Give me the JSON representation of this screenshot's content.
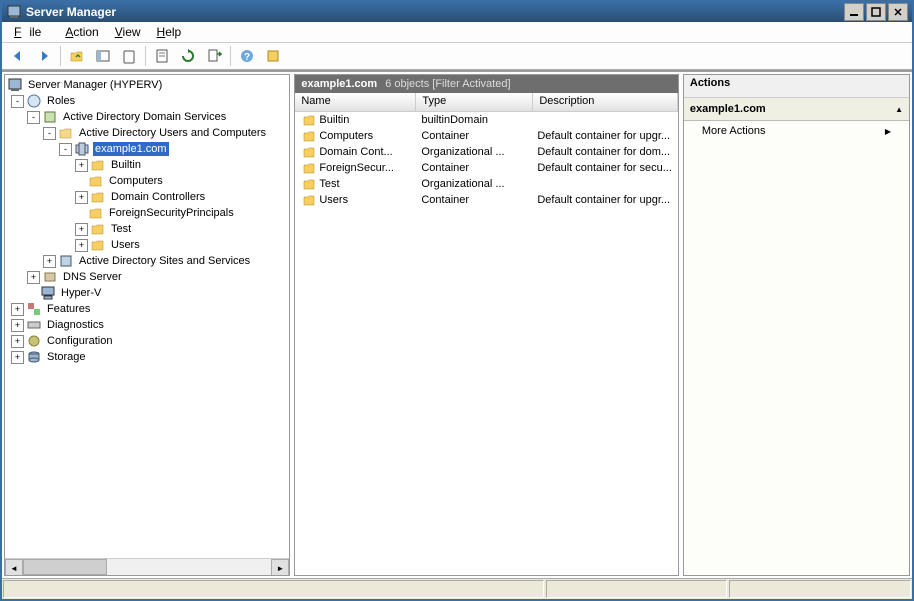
{
  "window_title": "Server Manager",
  "menu": {
    "file": "File",
    "action": "Action",
    "view": "View",
    "help": "Help"
  },
  "tree": {
    "root": "Server Manager (HYPERV)",
    "roles": "Roles",
    "adds": "Active Directory Domain Services",
    "aduc": "Active Directory Users and Computers",
    "domain": "example1.com",
    "builtin": "Builtin",
    "computers": "Computers",
    "dc": "Domain Controllers",
    "fsp": "ForeignSecurityPrincipals",
    "test": "Test",
    "users": "Users",
    "adss": "Active Directory Sites and Services",
    "dns": "DNS Server",
    "hyperv": "Hyper-V",
    "features": "Features",
    "diag": "Diagnostics",
    "config": "Configuration",
    "storage": "Storage"
  },
  "list": {
    "header_title": "example1.com",
    "header_info": "6 objects  [Filter Activated]",
    "col_name": "Name",
    "col_type": "Type",
    "col_desc": "Description",
    "rows": [
      {
        "name": "Builtin",
        "type": "builtinDomain",
        "desc": ""
      },
      {
        "name": "Computers",
        "type": "Container",
        "desc": "Default container for upgr..."
      },
      {
        "name": "Domain Cont...",
        "type": "Organizational ...",
        "desc": "Default container for dom..."
      },
      {
        "name": "ForeignSecur...",
        "type": "Container",
        "desc": "Default container for secu..."
      },
      {
        "name": "Test",
        "type": "Organizational ...",
        "desc": ""
      },
      {
        "name": "Users",
        "type": "Container",
        "desc": "Default container for upgr..."
      }
    ]
  },
  "actions": {
    "title": "Actions",
    "group": "example1.com",
    "more": "More Actions"
  }
}
